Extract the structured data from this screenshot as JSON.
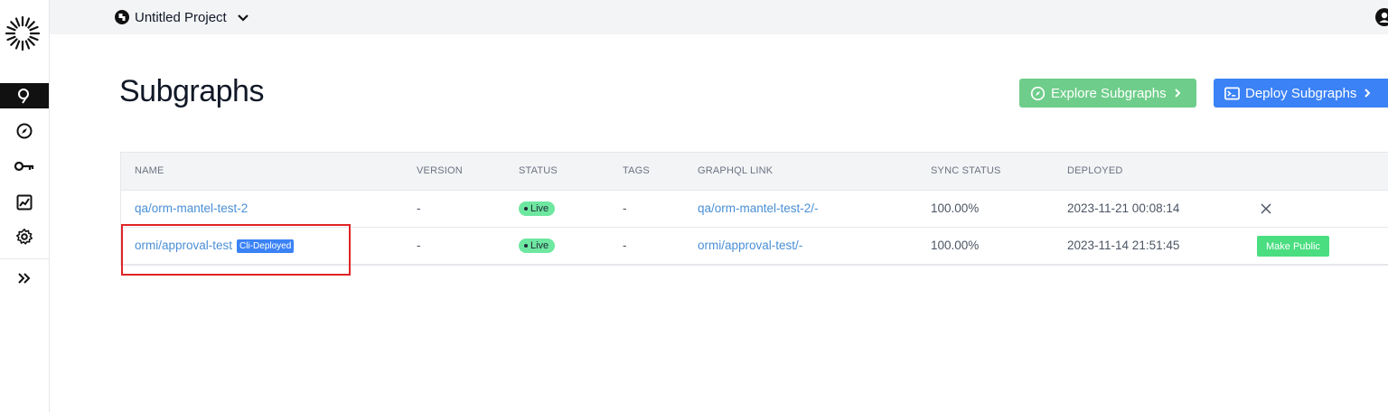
{
  "topbar": {
    "project_name": "Untitled Project",
    "project_icon": "project-icon",
    "dropdown_icon": "chevron-down-icon",
    "user_icon": "user-icon"
  },
  "sidebar": {
    "logo": "starburst-logo",
    "items": [
      {
        "icon": "subgraphs-icon",
        "active": true
      },
      {
        "icon": "compass-icon",
        "active": false
      },
      {
        "icon": "key-icon",
        "active": false
      },
      {
        "icon": "chart-icon",
        "active": false
      },
      {
        "icon": "gear-icon",
        "active": false
      },
      {
        "icon": "expand-icon",
        "active": false
      }
    ]
  },
  "header": {
    "title": "Subgraphs",
    "explore_button": "Explore Subgraphs",
    "deploy_button": "Deploy Subgraphs"
  },
  "table": {
    "columns": [
      "NAME",
      "VERSION",
      "STATUS",
      "TAGS",
      "GRAPHQL LINK",
      "SYNC STATUS",
      "DEPLOYED"
    ],
    "rows": [
      {
        "name": "qa/orm-mantel-test-2",
        "badge": "",
        "version": "-",
        "status": "Live",
        "tags": "-",
        "graphql_link": "qa/orm-mantel-test-2/-",
        "sync_status": "100.00%",
        "deployed": "2023-11-21 00:08:14",
        "action": "close"
      },
      {
        "name": "ormi/approval-test",
        "badge": "Cli-Deployed",
        "version": "-",
        "status": "Live",
        "tags": "-",
        "graphql_link": "ormi/approval-test/-",
        "sync_status": "100.00%",
        "deployed": "2023-11-14 21:51:45",
        "action": "Make Public"
      }
    ]
  },
  "colors": {
    "live_badge": "#6ee7a0",
    "explore_button": "#6ecd8a",
    "deploy_button": "#3b82f6",
    "link": "#4a8fd6",
    "highlight": "#e02424"
  }
}
